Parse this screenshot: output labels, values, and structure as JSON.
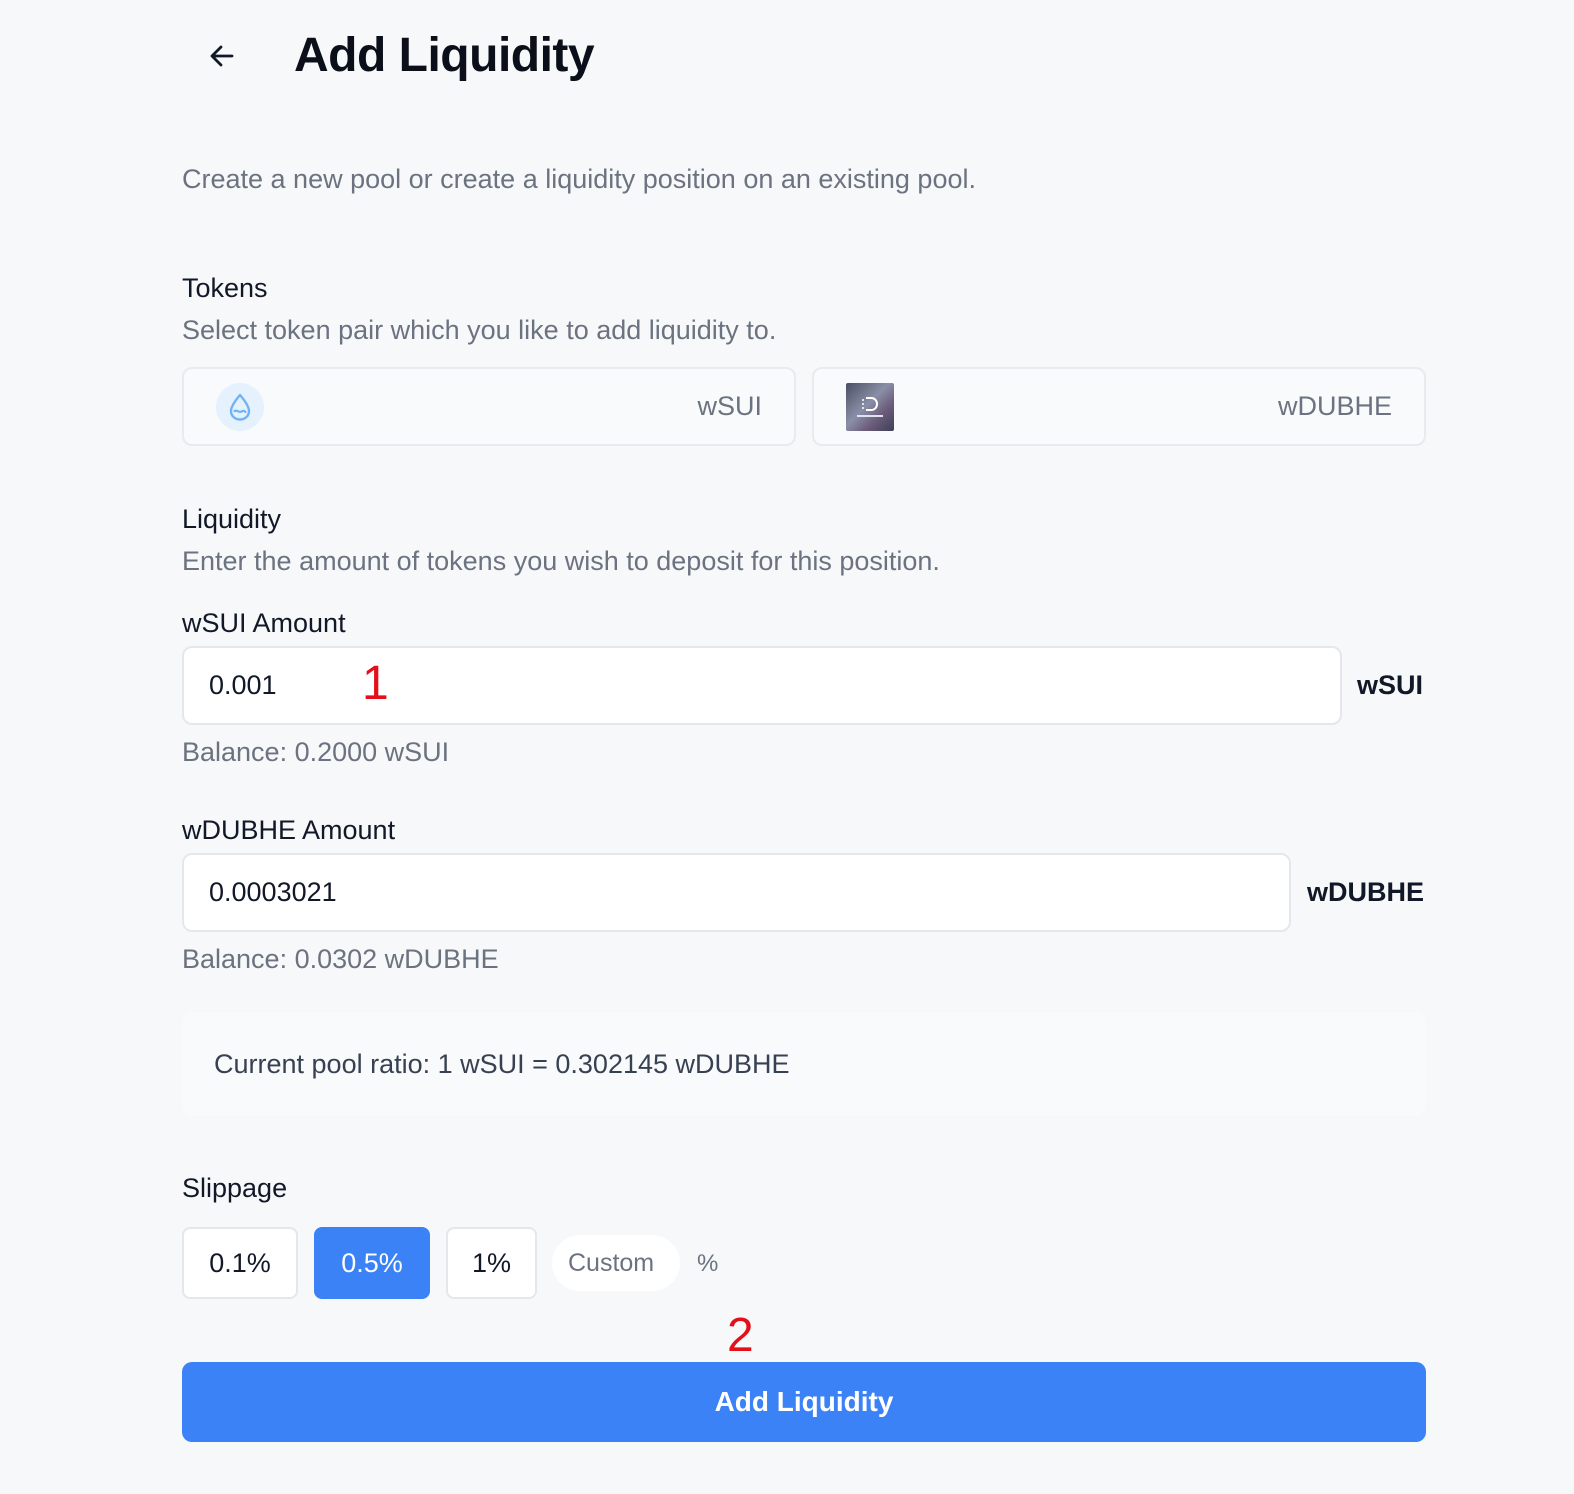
{
  "header": {
    "back_icon": "arrow-left-icon",
    "title": "Add Liquidity",
    "subtitle": "Create a new pool or create a liquidity position on an existing pool."
  },
  "tokens": {
    "title": "Tokens",
    "description": "Select token pair which you like to add liquidity to.",
    "token_a": {
      "name": "wSUI",
      "icon": "sui-droplet-icon"
    },
    "token_b": {
      "name": "wDUBHE",
      "icon": "dubhe-logo-icon"
    }
  },
  "liquidity": {
    "title": "Liquidity",
    "description": "Enter the amount of tokens you wish to deposit for this position.",
    "token_a": {
      "label": "wSUI Amount",
      "value": "0.001",
      "unit": "wSUI",
      "balance": "Balance: 0.2000 wSUI"
    },
    "token_b": {
      "label": "wDUBHE Amount",
      "value": "0.0003021",
      "unit": "wDUBHE",
      "balance": "Balance: 0.0302 wDUBHE"
    },
    "pool_ratio": "Current pool ratio: 1 wSUI = 0.302145 wDUBHE"
  },
  "slippage": {
    "title": "Slippage",
    "options": [
      "0.1%",
      "0.5%",
      "1%"
    ],
    "selected": "0.5%",
    "custom_placeholder": "Custom",
    "percent_sign": "%"
  },
  "submit": {
    "label": "Add Liquidity",
    "color": "#3b82f6"
  },
  "annotations": {
    "first": "1",
    "second": "2",
    "color": "#e3101a"
  }
}
